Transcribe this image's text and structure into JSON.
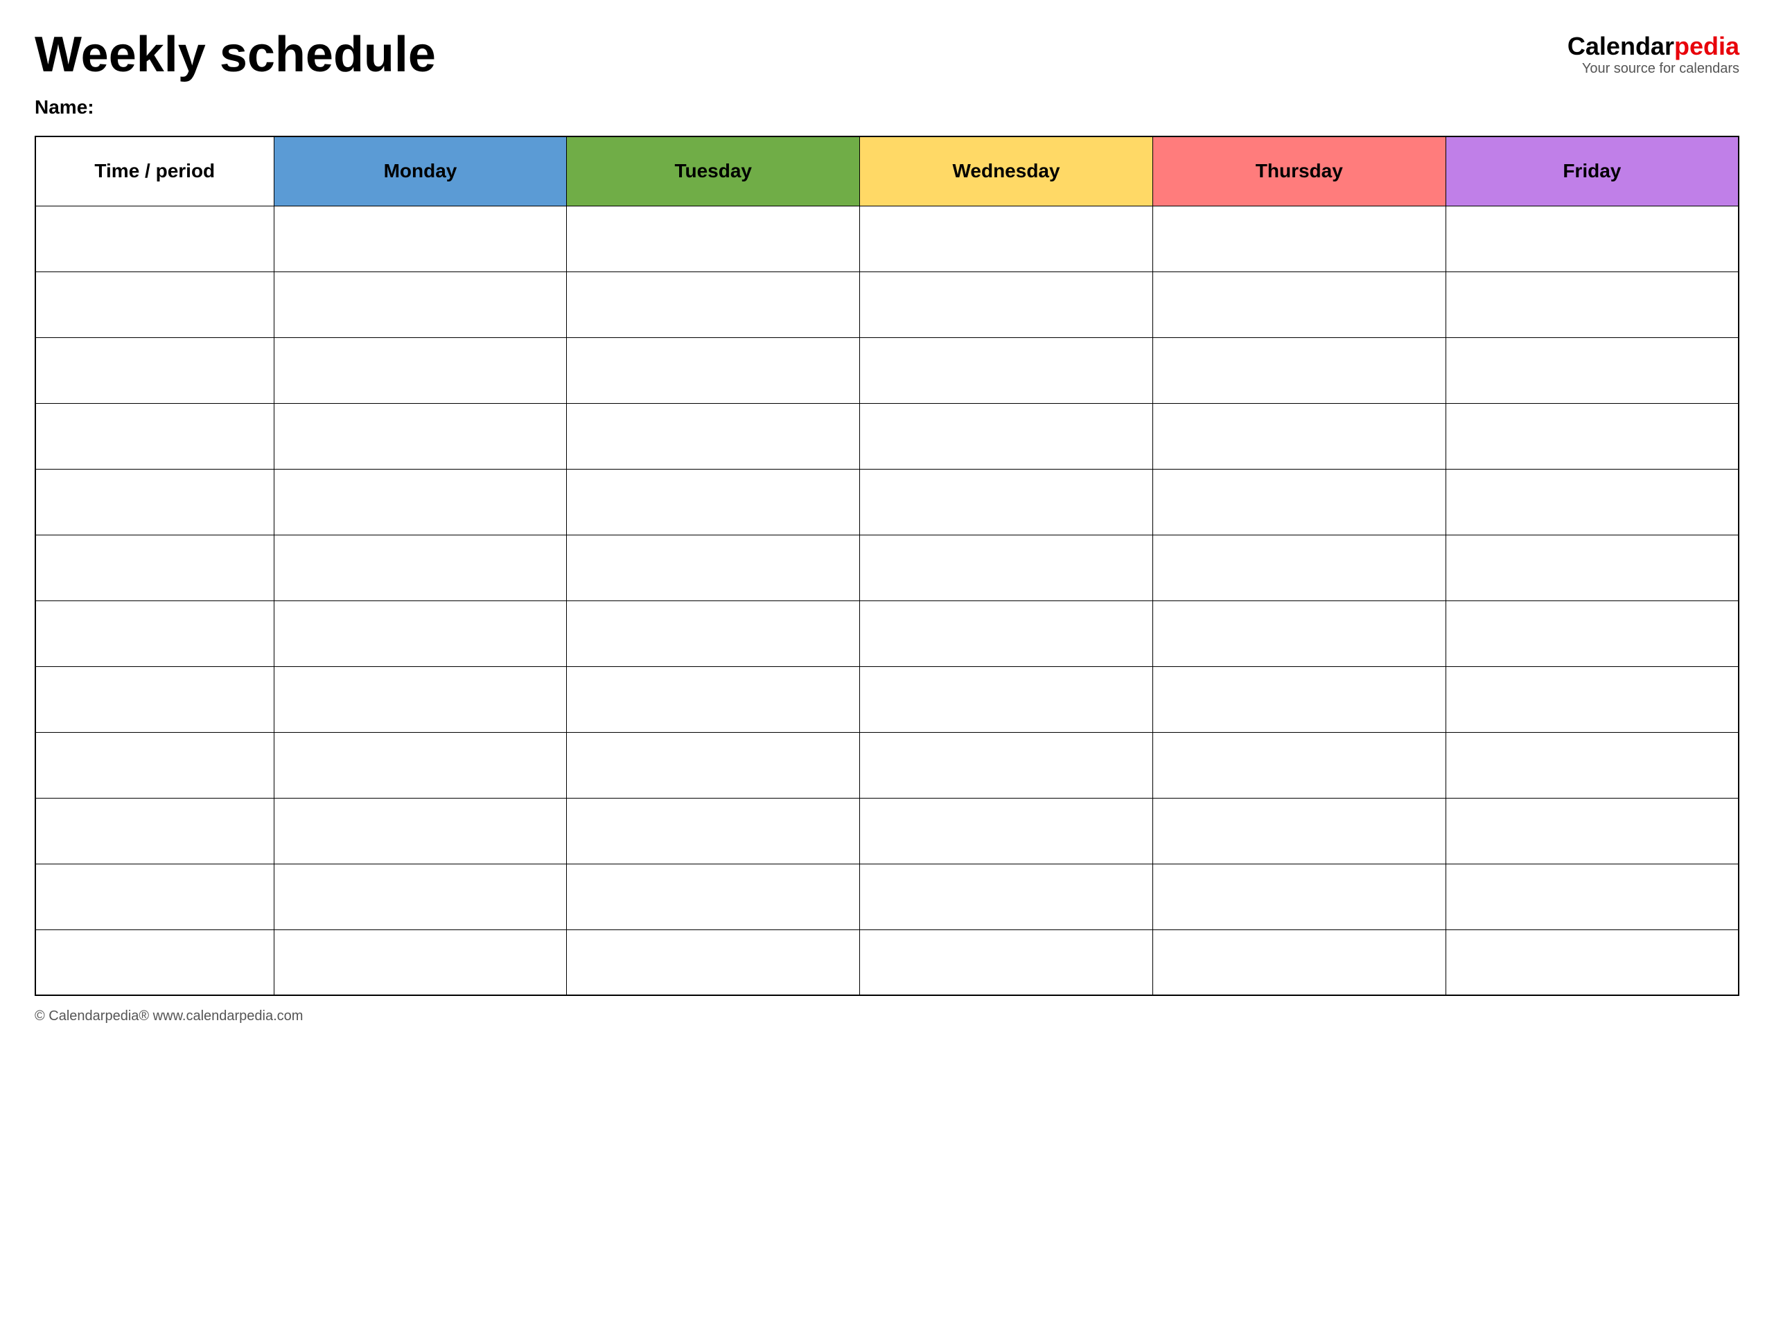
{
  "header": {
    "title": "Weekly schedule",
    "logo": {
      "calendar_part": "Calendar",
      "pedia_part": "pedia",
      "subtitle": "Your source for calendars"
    }
  },
  "name_label": "Name:",
  "table": {
    "columns": [
      {
        "key": "time",
        "label": "Time / period",
        "color": "#ffffff"
      },
      {
        "key": "monday",
        "label": "Monday",
        "color": "#5b9bd5"
      },
      {
        "key": "tuesday",
        "label": "Tuesday",
        "color": "#70ad47"
      },
      {
        "key": "wednesday",
        "label": "Wednesday",
        "color": "#ffd966"
      },
      {
        "key": "thursday",
        "label": "Thursday",
        "color": "#ff7c7c"
      },
      {
        "key": "friday",
        "label": "Friday",
        "color": "#c07fe8"
      }
    ],
    "row_count": 12
  },
  "footer": {
    "text": "© Calendarpedia®  www.calendarpedia.com"
  }
}
